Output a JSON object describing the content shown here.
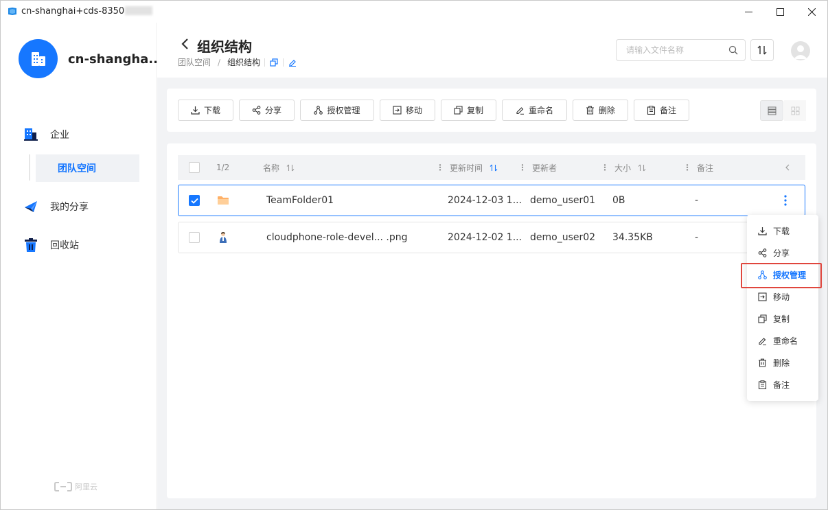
{
  "window": {
    "title": "cn-shanghai+cds-8350",
    "accent_color": "#1677ff",
    "controls": {
      "minimize": "minimize-icon",
      "maximize": "maximize-icon",
      "close": "close-icon"
    }
  },
  "sidebar": {
    "org_name": "cn-shangha...",
    "nav": [
      {
        "label": "企业",
        "icon": "enterprise-icon"
      },
      {
        "label": "团队空间",
        "icon": "",
        "active": true
      },
      {
        "label": "我的分享",
        "icon": "share-plane-icon"
      },
      {
        "label": "回收站",
        "icon": "recycle-bin-icon"
      }
    ],
    "brand": "阿里云"
  },
  "header": {
    "title": "组织结构",
    "breadcrumb": [
      "团队空间",
      "组织结构"
    ],
    "search_placeholder": "请输入文件名称"
  },
  "toolbar": {
    "buttons": [
      {
        "label": "下载",
        "icon": "download-icon"
      },
      {
        "label": "分享",
        "icon": "share-icon"
      },
      {
        "label": "授权管理",
        "icon": "authorize-icon"
      },
      {
        "label": "移动",
        "icon": "move-icon"
      },
      {
        "label": "复制",
        "icon": "copy-icon"
      },
      {
        "label": "重命名",
        "icon": "rename-icon"
      },
      {
        "label": "删除",
        "icon": "delete-icon"
      },
      {
        "label": "备注",
        "icon": "note-icon"
      }
    ]
  },
  "table": {
    "selection_count": "1/2",
    "columns": {
      "name": "名称",
      "updated": "更新时间",
      "updater": "更新者",
      "size": "大小",
      "note": "备注"
    },
    "rows": [
      {
        "name": "TeamFolder01",
        "updated": "2024-12-03 1...",
        "updater": "demo_user01",
        "size": "0B",
        "note": "-",
        "selected": true,
        "type": "folder"
      },
      {
        "name": "cloudphone-role-devel... .png",
        "updated": "2024-12-02 1...",
        "updater": "demo_user02",
        "size": "34.35KB",
        "note": "-",
        "selected": false,
        "type": "image"
      }
    ]
  },
  "context_menu": {
    "items": [
      {
        "label": "下载",
        "icon": "download-icon"
      },
      {
        "label": "分享",
        "icon": "share-icon"
      },
      {
        "label": "授权管理",
        "icon": "authorize-icon",
        "highlighted": true
      },
      {
        "label": "移动",
        "icon": "move-icon"
      },
      {
        "label": "复制",
        "icon": "copy-icon"
      },
      {
        "label": "重命名",
        "icon": "rename-icon"
      },
      {
        "label": "删除",
        "icon": "delete-icon"
      },
      {
        "label": "备注",
        "icon": "note-icon"
      }
    ],
    "highlight_color": "#e0463d"
  }
}
